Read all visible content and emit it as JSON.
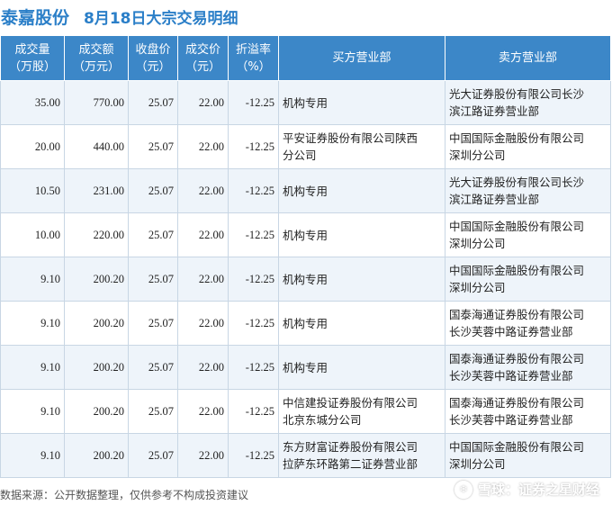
{
  "title": {
    "stock_name": "泰嘉股份",
    "description": "8月18日大宗交易明细"
  },
  "table": {
    "headers": {
      "volume": [
        "成交量",
        "（万股）"
      ],
      "amount": [
        "成交额",
        "（万元）"
      ],
      "close": [
        "收盘价",
        "（元）"
      ],
      "price": [
        "成交价",
        "（元）"
      ],
      "premium": [
        "折溢率",
        "（%）"
      ],
      "buyer": "买方营业部",
      "seller": "卖方营业部"
    },
    "rows": [
      {
        "volume": "35.00",
        "amount": "770.00",
        "close": "25.07",
        "price": "22.00",
        "premium": "-12.25",
        "buyer": [
          "机构专用"
        ],
        "seller": [
          "光大证券股份有限公司长沙",
          "滨江路证券营业部"
        ]
      },
      {
        "volume": "20.00",
        "amount": "440.00",
        "close": "25.07",
        "price": "22.00",
        "premium": "-12.25",
        "buyer": [
          "平安证券股份有限公司陕西",
          "分公司"
        ],
        "seller": [
          "中国国际金融股份有限公司",
          "深圳分公司"
        ]
      },
      {
        "volume": "10.50",
        "amount": "231.00",
        "close": "25.07",
        "price": "22.00",
        "premium": "-12.25",
        "buyer": [
          "机构专用"
        ],
        "seller": [
          "光大证券股份有限公司长沙",
          "滨江路证券营业部"
        ]
      },
      {
        "volume": "10.00",
        "amount": "220.00",
        "close": "25.07",
        "price": "22.00",
        "premium": "-12.25",
        "buyer": [
          "机构专用"
        ],
        "seller": [
          "中国国际金融股份有限公司",
          "深圳分公司"
        ]
      },
      {
        "volume": "9.10",
        "amount": "200.20",
        "close": "25.07",
        "price": "22.00",
        "premium": "-12.25",
        "buyer": [
          "机构专用"
        ],
        "seller": [
          "中国国际金融股份有限公司",
          "深圳分公司"
        ]
      },
      {
        "volume": "9.10",
        "amount": "200.20",
        "close": "25.07",
        "price": "22.00",
        "premium": "-12.25",
        "buyer": [
          "机构专用"
        ],
        "seller": [
          "国泰海通证券股份有限公司",
          "长沙芙蓉中路证券营业部"
        ]
      },
      {
        "volume": "9.10",
        "amount": "200.20",
        "close": "25.07",
        "price": "22.00",
        "premium": "-12.25",
        "buyer": [
          "机构专用"
        ],
        "seller": [
          "国泰海通证券股份有限公司",
          "长沙芙蓉中路证券营业部"
        ]
      },
      {
        "volume": "9.10",
        "amount": "200.20",
        "close": "25.07",
        "price": "22.00",
        "premium": "-12.25",
        "buyer": [
          "中信建投证券股份有限公司",
          "北京东城分公司"
        ],
        "seller": [
          "国泰海通证券股份有限公司",
          "长沙芙蓉中路证券营业部"
        ]
      },
      {
        "volume": "9.10",
        "amount": "200.20",
        "close": "25.07",
        "price": "22.00",
        "premium": "-12.25",
        "buyer": [
          "东方财富证券股份有限公司",
          "拉萨东环路第二证券营业部"
        ],
        "seller": [
          "中国国际金融股份有限公司",
          "深圳分公司"
        ]
      }
    ]
  },
  "watermark": "证券之星",
  "footer": {
    "source": "数据来源：公开数据整理，仅供参考不构成投资建议",
    "brand": "雪球：证券之星财经",
    "brand_icon": "snowball-icon"
  },
  "colors": {
    "header_bg": "#3c87c8",
    "title": "#2b7fc8",
    "negative": "#2ea44f",
    "row_alt": "#eef4fa"
  }
}
